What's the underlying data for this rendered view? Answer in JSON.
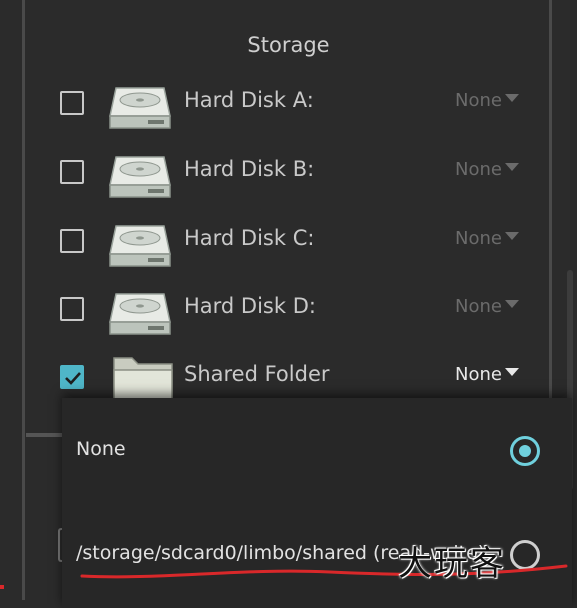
{
  "dialog": {
    "title": "Storage"
  },
  "storage_items": [
    {
      "label": "Hard Disk A:",
      "checked": false,
      "value": "None",
      "icon": "hard-disk-icon"
    },
    {
      "label": "Hard Disk B:",
      "checked": false,
      "value": "None",
      "icon": "hard-disk-icon"
    },
    {
      "label": "Hard Disk C:",
      "checked": false,
      "value": "None",
      "icon": "hard-disk-icon"
    },
    {
      "label": "Hard Disk D:",
      "checked": false,
      "value": "None",
      "icon": "hard-disk-icon"
    },
    {
      "label": "Shared Folder",
      "checked": true,
      "value": "None",
      "icon": "folder-icon"
    }
  ],
  "popup": {
    "options": [
      {
        "label": "None",
        "selected": true
      },
      {
        "label": "/storage/sdcard0/limbo/shared (read-write)",
        "selected": false
      }
    ]
  },
  "watermark": "大玩客",
  "colors": {
    "background": "#2b2b2b",
    "accent": "#4fb6c8",
    "annotation": "#d9282a"
  }
}
